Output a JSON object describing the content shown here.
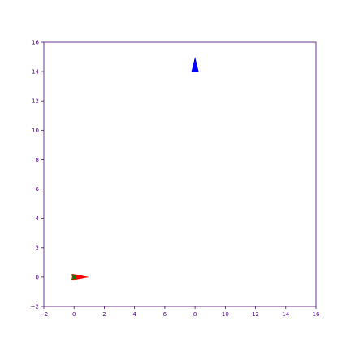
{
  "chart_data": {
    "type": "scatter",
    "title": "",
    "xlabel": "",
    "ylabel": "",
    "xlim": [
      -2,
      16
    ],
    "ylim": [
      -2,
      16
    ],
    "xticks": [
      -2,
      0,
      2,
      4,
      6,
      8,
      10,
      12,
      14,
      16
    ],
    "yticks": [
      -2,
      0,
      2,
      4,
      6,
      8,
      10,
      12,
      14,
      16
    ],
    "grid": false,
    "legend": "none",
    "colors": {
      "axis": "#4b0082",
      "blue_marker": "#0000ff",
      "red_marker": "#ff0000",
      "green_marker": "#008000"
    },
    "series": [
      {
        "marker": "triangle-up",
        "color": "#0000ff",
        "points": [
          {
            "x": 8.0,
            "y": 14.5
          }
        ]
      },
      {
        "marker": "triangle-right",
        "color": "#ff0000",
        "points": [
          {
            "x": 0.4,
            "y": 0.0
          }
        ]
      },
      {
        "marker": "x",
        "color": "#008000",
        "points": [
          {
            "x": 0.0,
            "y": 0.0
          }
        ]
      }
    ]
  }
}
